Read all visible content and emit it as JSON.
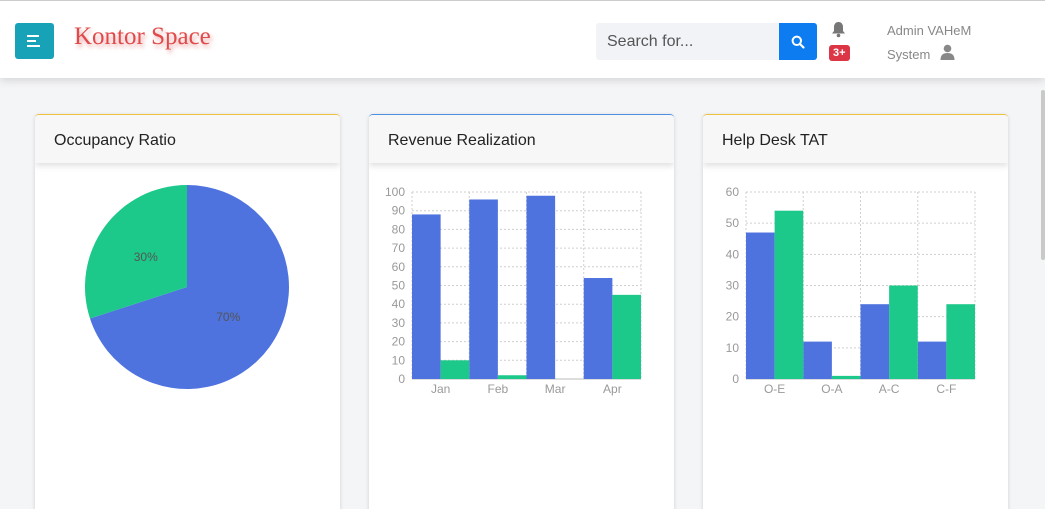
{
  "header": {
    "brand": "Kontor Space",
    "search_placeholder": "Search for...",
    "notification_badge": "3+",
    "user_name": "Admin VAHeM",
    "user_role": "System"
  },
  "cards": [
    {
      "title": "Occupancy Ratio",
      "accent": "#f0c040",
      "chart_data": {
        "type": "pie",
        "labels": [
          "70%",
          "30%"
        ],
        "values": [
          70,
          30
        ],
        "colors": [
          "#4e73df",
          "#1cc88a"
        ]
      }
    },
    {
      "title": "Revenue Realization",
      "accent": "#4e8fe0",
      "chart_data": {
        "type": "bar",
        "categories": [
          "Jan",
          "Feb",
          "Mar",
          "Apr"
        ],
        "series": [
          {
            "values": [
              88,
              96,
              98,
              54
            ],
            "color": "#4e73df"
          },
          {
            "values": [
              10,
              2,
              0,
              45
            ],
            "color": "#1cc88a"
          }
        ],
        "ylim": [
          0,
          100
        ],
        "yticks": [
          0,
          10,
          20,
          30,
          40,
          50,
          60,
          70,
          80,
          90,
          100
        ],
        "grid": true
      }
    },
    {
      "title": "Help Desk TAT",
      "accent": "#f0c040",
      "chart_data": {
        "type": "bar",
        "categories": [
          "O-E",
          "O-A",
          "A-C",
          "C-F"
        ],
        "series": [
          {
            "values": [
              47,
              12,
              24,
              12
            ],
            "color": "#4e73df"
          },
          {
            "values": [
              54,
              1,
              30,
              24
            ],
            "color": "#1cc88a"
          }
        ],
        "ylim": [
          0,
          60
        ],
        "yticks": [
          0,
          10,
          20,
          30,
          40,
          50,
          60
        ],
        "grid": true
      }
    }
  ]
}
